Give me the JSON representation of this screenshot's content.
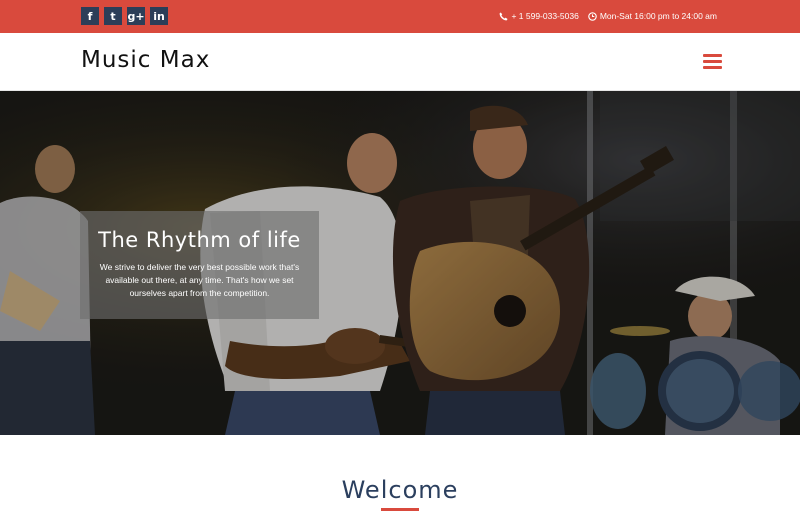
{
  "topbar": {
    "social": [
      {
        "icon": "facebook-icon",
        "glyph": "f"
      },
      {
        "icon": "twitter-icon",
        "glyph": "t"
      },
      {
        "icon": "google-plus-icon",
        "glyph": "g+"
      },
      {
        "icon": "linkedin-icon",
        "glyph": "in"
      }
    ],
    "phone": "+ 1 599-033-5036",
    "hours": "Mon-Sat 16:00 pm to 24:00 am"
  },
  "header": {
    "logo": "Music Max",
    "menu_icon": "hamburger-menu-icon"
  },
  "hero": {
    "title": "The Rhythm of life",
    "text": "We strive to deliver the very best possible work that's available out there, at any time. That's how we set ourselves apart from the competition."
  },
  "welcome": {
    "title": "Welcome"
  },
  "colors": {
    "accent": "#d94a3d",
    "social_bg": "#2c3e58",
    "heading": "#2b3f5e"
  }
}
